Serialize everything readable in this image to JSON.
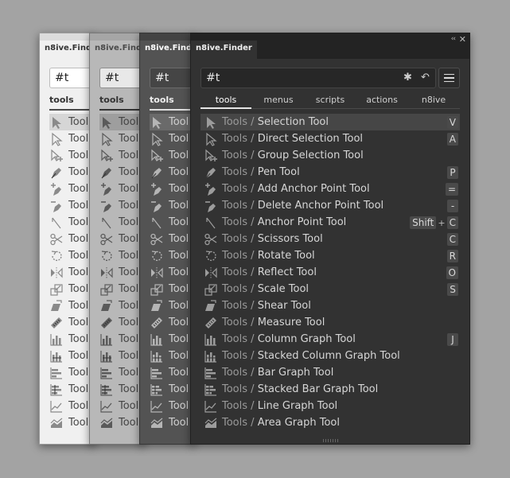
{
  "panel_title": "n8ive.Finder",
  "search": {
    "value": "#t"
  },
  "header_buttons": {
    "collapse": "‹‹",
    "close": "✕"
  },
  "search_buttons": {
    "clear": "✱",
    "back": "↶"
  },
  "tabs": [
    "tools",
    "menus",
    "scripts",
    "actions",
    "n8ive"
  ],
  "active_tab": "tools",
  "results": [
    {
      "category": "Tools",
      "name": "Selection Tool",
      "icon": "selection-tool-icon",
      "keys": [
        "V"
      ]
    },
    {
      "category": "Tools",
      "name": "Direct Selection Tool",
      "icon": "direct-selection-tool-icon",
      "keys": [
        "A"
      ]
    },
    {
      "category": "Tools",
      "name": "Group Selection Tool",
      "icon": "group-selection-tool-icon",
      "keys": []
    },
    {
      "category": "Tools",
      "name": "Pen Tool",
      "icon": "pen-tool-icon",
      "keys": [
        "P"
      ]
    },
    {
      "category": "Tools",
      "name": "Add Anchor Point Tool",
      "icon": "add-anchor-point-tool-icon",
      "keys": [
        "="
      ]
    },
    {
      "category": "Tools",
      "name": "Delete Anchor Point Tool",
      "icon": "delete-anchor-point-tool-icon",
      "keys": [
        "-"
      ]
    },
    {
      "category": "Tools",
      "name": "Anchor Point Tool",
      "icon": "anchor-point-tool-icon",
      "keys": [
        "Shift",
        "C"
      ]
    },
    {
      "category": "Tools",
      "name": "Scissors Tool",
      "icon": "scissors-tool-icon",
      "keys": [
        "C"
      ]
    },
    {
      "category": "Tools",
      "name": "Rotate Tool",
      "icon": "rotate-tool-icon",
      "keys": [
        "R"
      ]
    },
    {
      "category": "Tools",
      "name": "Reflect Tool",
      "icon": "reflect-tool-icon",
      "keys": [
        "O"
      ]
    },
    {
      "category": "Tools",
      "name": "Scale Tool",
      "icon": "scale-tool-icon",
      "keys": [
        "S"
      ]
    },
    {
      "category": "Tools",
      "name": "Shear Tool",
      "icon": "shear-tool-icon",
      "keys": []
    },
    {
      "category": "Tools",
      "name": "Measure Tool",
      "icon": "measure-tool-icon",
      "keys": []
    },
    {
      "category": "Tools",
      "name": "Column Graph Tool",
      "icon": "column-graph-tool-icon",
      "keys": [
        "J"
      ]
    },
    {
      "category": "Tools",
      "name": "Stacked Column Graph Tool",
      "icon": "stacked-column-graph-tool-icon",
      "keys": []
    },
    {
      "category": "Tools",
      "name": "Bar Graph Tool",
      "icon": "bar-graph-tool-icon",
      "keys": []
    },
    {
      "category": "Tools",
      "name": "Stacked Bar Graph Tool",
      "icon": "stacked-bar-graph-tool-icon",
      "keys": []
    },
    {
      "category": "Tools",
      "name": "Line Graph Tool",
      "icon": "line-graph-tool-icon",
      "keys": []
    },
    {
      "category": "Tools",
      "name": "Area Graph Tool",
      "icon": "area-graph-tool-icon",
      "keys": []
    }
  ],
  "preview_label": "Tool",
  "colors": {
    "light_panel": "#f0f0f0",
    "medium_panel": "#b8b8b8",
    "dark_panel": "#535353",
    "darkest_panel": "#323232",
    "backdrop": "#a3a3a3"
  }
}
